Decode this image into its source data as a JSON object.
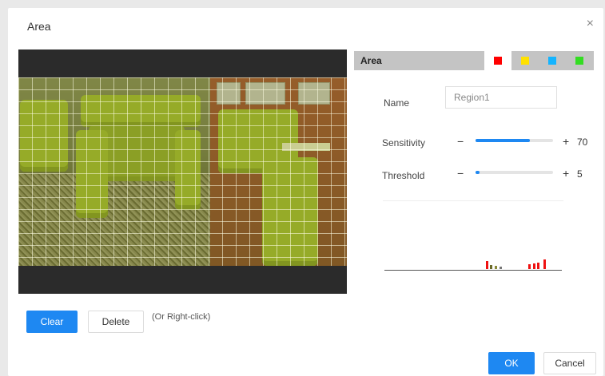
{
  "dialog": {
    "title": "Area",
    "close_glyph": "×"
  },
  "area_selector": {
    "label": "Area",
    "swatches": [
      {
        "name": "red",
        "color": "#ff0000",
        "selected": true
      },
      {
        "name": "yellow",
        "color": "#ffe100",
        "selected": false
      },
      {
        "name": "blue",
        "color": "#14b4ff",
        "selected": false
      },
      {
        "name": "green",
        "color": "#33dd22",
        "selected": false
      }
    ]
  },
  "form": {
    "name_label": "Name",
    "name_value": "Region1",
    "sensitivity_label": "Sensitivity",
    "sensitivity_value": "70",
    "threshold_label": "Threshold",
    "threshold_value": "5",
    "minus_glyph": "−",
    "plus_glyph": "+"
  },
  "sliders": {
    "sensitivity": 70,
    "threshold": 5,
    "fill_color": "#1e88f2"
  },
  "actions": {
    "clear_label": "Clear",
    "delete_label": "Delete",
    "delete_hint": "(Or Right-click)",
    "ok_label": "OK",
    "cancel_label": "Cancel"
  }
}
